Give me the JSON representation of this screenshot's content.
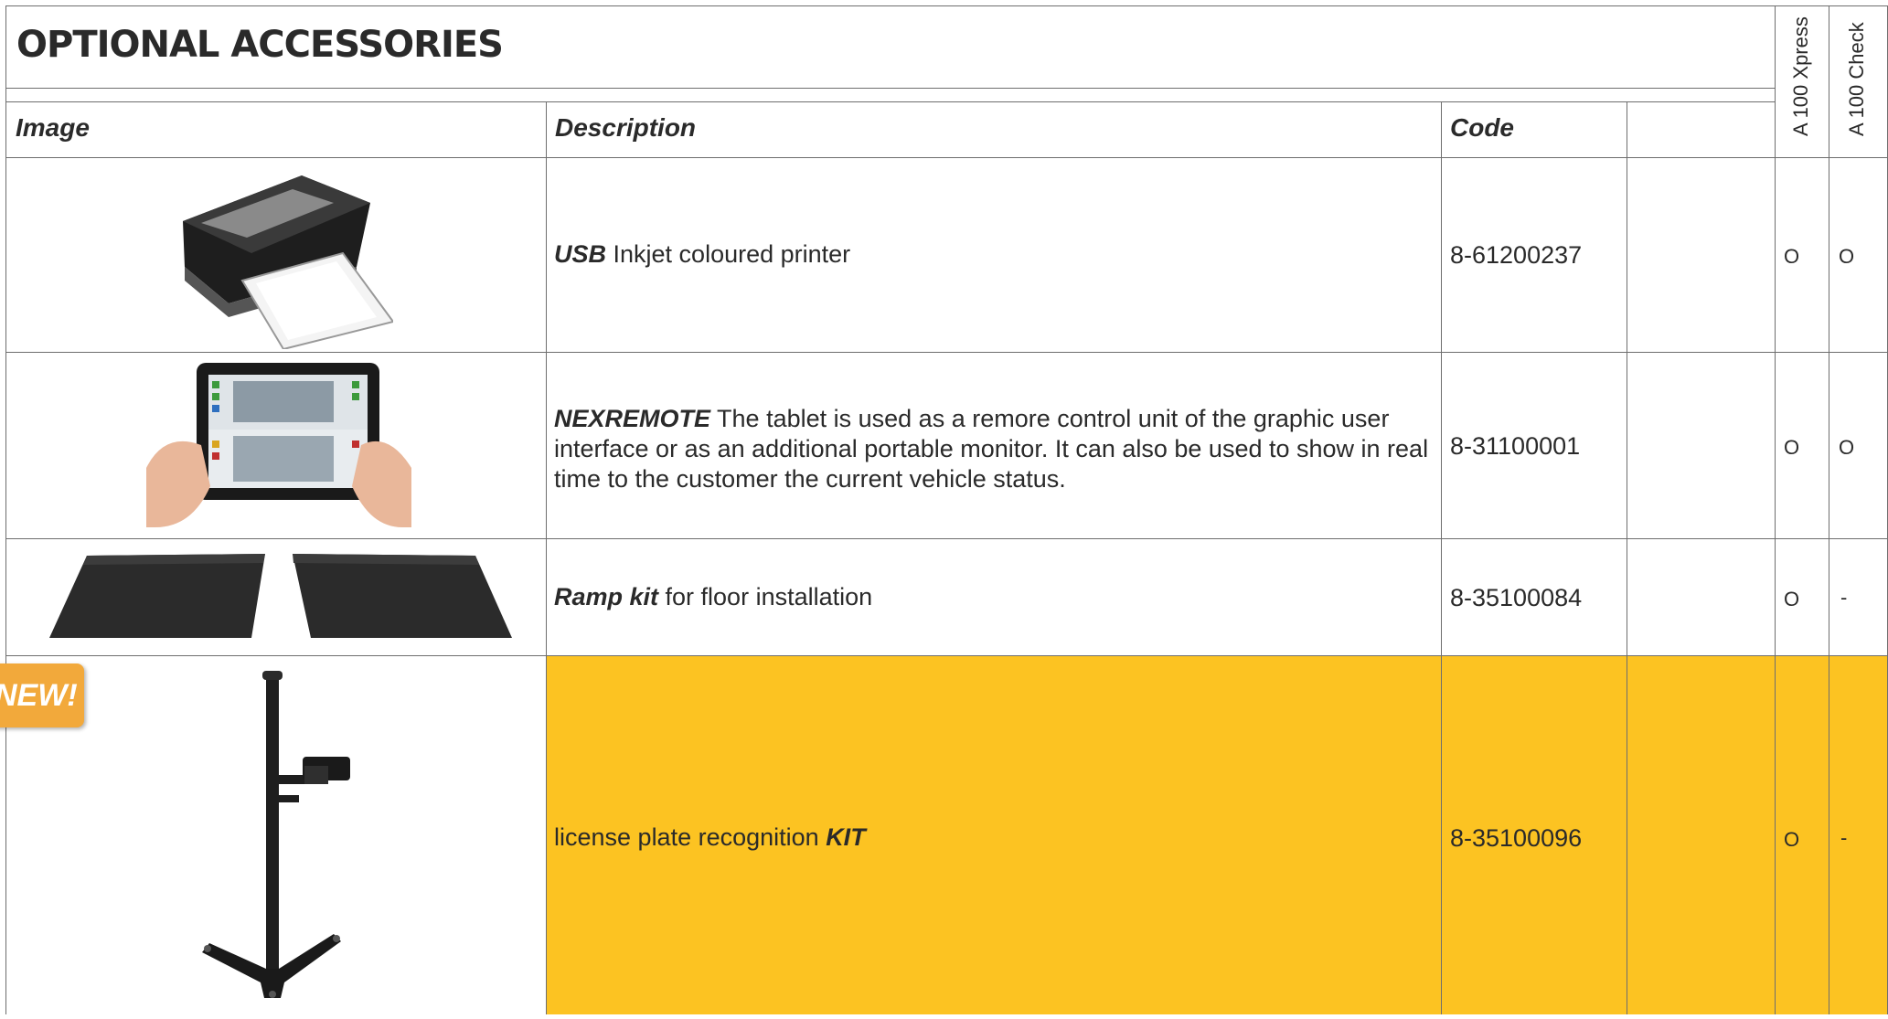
{
  "title": "OPTIONAL ACCESSORIES",
  "columns": {
    "image": "Image",
    "description": "Description",
    "code": "Code",
    "model_1": "A 100 Xpress",
    "model_2": "A 100 Check"
  },
  "badge": "NEW!",
  "rows": [
    {
      "desc_bold": "USB",
      "desc_text": " Inkjet coloured printer",
      "code": "8-61200237",
      "m1": "O",
      "m2": "O",
      "image": "printer-image"
    },
    {
      "desc_bold": "NEXREMOTE",
      "desc_text": " The tablet is used as a remore control unit of the graphic user interface or as an additional portable monitor. It can also be used to show in real time to the customer the current vehicle status.",
      "code": "8-31100001",
      "m1": "O",
      "m2": "O",
      "image": "tablet-image"
    },
    {
      "desc_bold": "Ramp kit",
      "desc_text": " for floor installation",
      "code": "8-35100084",
      "m1": "O",
      "m2": "-",
      "image": "ramp-kit-image"
    },
    {
      "desc_pre": "license plate recognition ",
      "desc_bold": "KIT",
      "code": "8-35100096",
      "m1": "O",
      "m2": "-",
      "image": "plate-recognition-stand-image",
      "highlight_color": "#fcc322"
    }
  ]
}
